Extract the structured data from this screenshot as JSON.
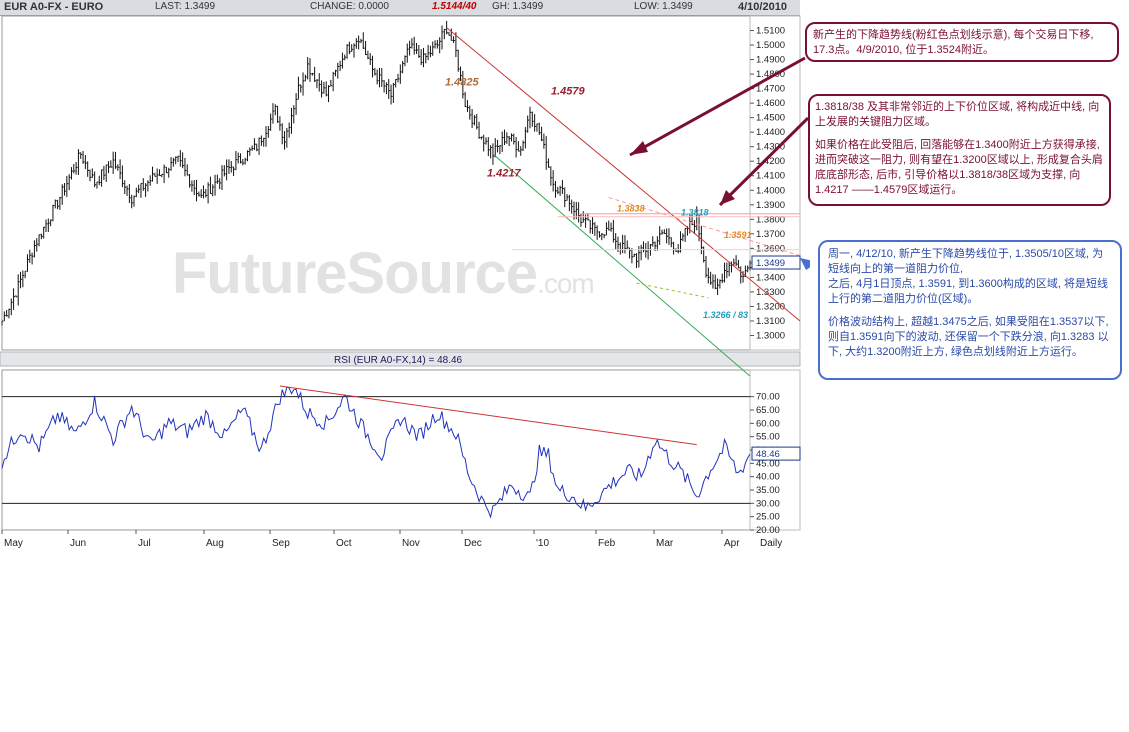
{
  "header": {
    "symbol": "EUR A0-FX - EURO",
    "last": "LAST: 1.3499",
    "high_marker": "1.5144/40",
    "gh": "GH: 1.3499",
    "change": "CHANGE: 0.0000",
    "low": "LOW: 1.3499",
    "date": "4/10/2010"
  },
  "watermark": {
    "main": "FutureSource",
    "suffix": ".com"
  },
  "chart_data": [
    {
      "type": "candlestick",
      "ylim": [
        1.29,
        1.52
      ],
      "yticks": [
        "1.5100",
        "1.5000",
        "1.4900",
        "1.4800",
        "1.4700",
        "1.4600",
        "1.4500",
        "1.4400",
        "1.4300",
        "1.4200",
        "1.4100",
        "1.4000",
        "1.3900",
        "1.3800",
        "1.3700",
        "1.3600",
        "1.3500",
        "1.3400",
        "1.3300",
        "1.3200",
        "1.3100",
        "1.3000"
      ],
      "xticks": [
        "May",
        "Jun",
        "Jul",
        "Aug",
        "Sep",
        "Oct",
        "Nov",
        "Dec",
        "'10",
        "Feb",
        "Mar",
        "Apr",
        "Daily"
      ],
      "last_value_label": "1.3499",
      "anchors": [
        [
          0,
          1.31
        ],
        [
          6,
          1.33
        ],
        [
          14,
          1.362
        ],
        [
          24,
          1.392
        ],
        [
          34,
          1.425
        ],
        [
          40,
          1.405
        ],
        [
          48,
          1.42
        ],
        [
          56,
          1.395
        ],
        [
          66,
          1.41
        ],
        [
          76,
          1.42
        ],
        [
          86,
          1.395
        ],
        [
          98,
          1.415
        ],
        [
          110,
          1.43
        ],
        [
          118,
          1.455
        ],
        [
          122,
          1.435
        ],
        [
          128,
          1.47
        ],
        [
          132,
          1.486
        ],
        [
          140,
          1.466
        ],
        [
          148,
          1.495
        ],
        [
          154,
          1.506
        ],
        [
          160,
          1.483
        ],
        [
          168,
          1.465
        ],
        [
          176,
          1.498
        ],
        [
          182,
          1.49
        ],
        [
          188,
          1.5
        ],
        [
          192,
          1.512
        ],
        [
          196,
          1.495
        ],
        [
          200,
          1.46
        ],
        [
          206,
          1.44
        ],
        [
          212,
          1.425
        ],
        [
          218,
          1.438
        ],
        [
          224,
          1.428
        ],
        [
          228,
          1.455
        ],
        [
          232,
          1.44
        ],
        [
          238,
          1.405
        ],
        [
          244,
          1.395
        ],
        [
          250,
          1.38
        ],
        [
          256,
          1.372
        ],
        [
          262,
          1.372
        ],
        [
          268,
          1.36
        ],
        [
          274,
          1.354
        ],
        [
          280,
          1.362
        ],
        [
          286,
          1.37
        ],
        [
          292,
          1.359
        ],
        [
          296,
          1.374
        ],
        [
          300,
          1.38
        ],
        [
          304,
          1.345
        ],
        [
          308,
          1.33
        ],
        [
          312,
          1.345
        ],
        [
          316,
          1.352
        ],
        [
          320,
          1.34
        ],
        [
          323,
          1.3499
        ]
      ],
      "annotations": [
        {
          "text": "1.4825",
          "color": "#b06a3a"
        },
        {
          "text": "1.4579",
          "color": "#9a2030"
        },
        {
          "text": "1.4217",
          "color": "#9a2030"
        },
        {
          "text": "1.3838",
          "color": "#e08a20"
        },
        {
          "text": "1.3818",
          "color": "#20a0c0"
        },
        {
          "text": "1.3591",
          "color": "#e08a20"
        },
        {
          "text": "1.3266 / 83",
          "color": "#20a0c0"
        }
      ]
    },
    {
      "type": "line",
      "title": "RSI (EUR A0-FX,14) = 48.46",
      "ylim": [
        20,
        80
      ],
      "yticks": [
        "70.00",
        "65.00",
        "60.00",
        "55.00",
        "50.00",
        "45.00",
        "40.00",
        "35.00",
        "30.00",
        "25.00",
        "20.00"
      ],
      "last_value_label": "48.46",
      "anchors": [
        [
          0,
          46
        ],
        [
          8,
          58
        ],
        [
          16,
          51
        ],
        [
          24,
          63
        ],
        [
          32,
          56
        ],
        [
          40,
          68
        ],
        [
          48,
          54
        ],
        [
          56,
          66
        ],
        [
          64,
          52
        ],
        [
          72,
          60
        ],
        [
          80,
          57
        ],
        [
          88,
          63
        ],
        [
          96,
          55
        ],
        [
          104,
          65
        ],
        [
          112,
          50
        ],
        [
          120,
          70
        ],
        [
          126,
          74
        ],
        [
          132,
          64
        ],
        [
          140,
          60
        ],
        [
          148,
          70
        ],
        [
          156,
          58
        ],
        [
          164,
          48
        ],
        [
          172,
          62
        ],
        [
          180,
          55
        ],
        [
          188,
          64
        ],
        [
          196,
          56
        ],
        [
          202,
          40
        ],
        [
          208,
          30
        ],
        [
          212,
          27
        ],
        [
          220,
          37
        ],
        [
          228,
          32
        ],
        [
          232,
          49
        ],
        [
          236,
          48
        ],
        [
          240,
          35
        ],
        [
          246,
          33
        ],
        [
          252,
          28
        ],
        [
          258,
          33
        ],
        [
          264,
          38
        ],
        [
          270,
          42
        ],
        [
          276,
          40
        ],
        [
          282,
          54
        ],
        [
          288,
          47
        ],
        [
          294,
          41
        ],
        [
          300,
          33
        ],
        [
          306,
          43
        ],
        [
          312,
          51
        ],
        [
          318,
          41
        ],
        [
          323,
          48.46
        ]
      ]
    }
  ],
  "notes": {
    "box1": "新产生的下降趋势线(粉红色点划线示意), 每个交易日下移, 17.3点。4/9/2010, 位于1.3524附近。",
    "box2_p1": "1.3818/38 及其非常邻近的上下价位区域, 将构成近中线, 向上发展的关键阻力区域。",
    "box2_p2": "如果价格在此受阻后, 回落能够在1.3400附近上方获得承接, 进而突破这一阻力, 则有望在1.3200区域以上, 形成复合头肩底底部形态, 后市, 引导价格以1.3818/38区域为支撑, 向1.4217 ——1.4579区域运行。",
    "box3_p1": "周一, 4/12/10, 新产生下降趋势线位于, 1.3505/10区域, 为短线向上的第一道阻力价位,",
    "box3_p2": "之后, 4月1日顶点, 1.3591, 到1.3600构成的区域, 将是短线上行的第二道阻力价位(区域)。",
    "box3_p3": "价格波动结构上, 超越1.3475之后, 如果受阻在1.3537以下, 则自1.3591向下的波动, 还保留一个下跌分浪, 向1.3283 以下, 大约1.3200附近上方, 绿色点划线附近上方运行。"
  }
}
